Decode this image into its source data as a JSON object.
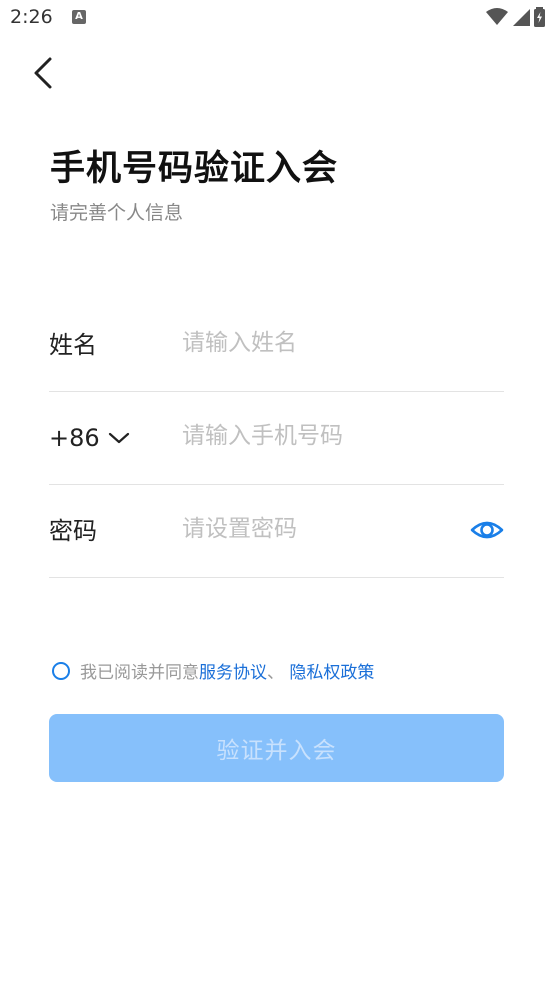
{
  "status_bar": {
    "time": "2:26",
    "notification_icon_letter": "A"
  },
  "header": {
    "title": "手机号码验证入会",
    "subtitle": "请完善个人信息"
  },
  "form": {
    "name": {
      "label": "姓名",
      "placeholder": "请输入姓名",
      "value": ""
    },
    "phone": {
      "country_code": "+86",
      "placeholder": "请输入手机号码",
      "value": ""
    },
    "password": {
      "label": "密码",
      "placeholder": "请设置密码",
      "value": ""
    }
  },
  "agreement": {
    "checked": false,
    "prefix": "我已阅读并同意",
    "service_link": "服务协议",
    "separator": "、 ",
    "privacy_link": "隐私权政策"
  },
  "submit": {
    "label": "验证并入会",
    "enabled": false
  },
  "colors": {
    "accent": "#1a7fe8",
    "button_disabled": "#86c0fb",
    "placeholder": "#c0c0c0"
  }
}
